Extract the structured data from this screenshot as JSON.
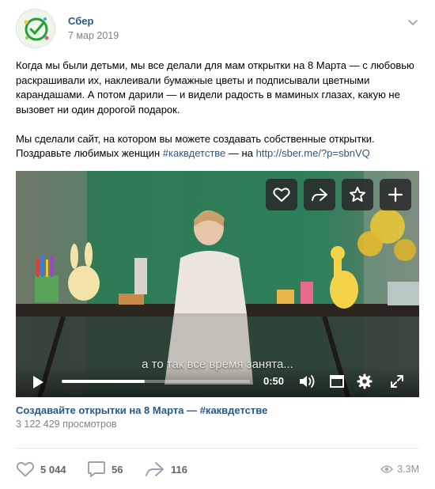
{
  "post": {
    "author": "Сбер",
    "date": "7 мар 2019",
    "text_p1": "Когда мы были детьми, мы все делали для мам открытки на 8 Марта — с любовью раскрашивали их, наклеивали бумажные цветы и подписывали цветными карандашами. А потом дарили — и видели радость в маминых глазах, какую не вызовет ни один дорогой подарок.",
    "text_p2_line1": "Мы сделали сайт, на котором вы можете создавать собственные открытки.",
    "text_p2_prefix": "Поздравьте любимых женщин",
    "hashtag": "#каквдетстве",
    "text_p2_middle": "— на",
    "link": "http://sber.me/?p=sbnVQ"
  },
  "video": {
    "subtitle": "а то так всё время занята...",
    "time": "0:50",
    "progress": 0.44,
    "title": "Создавайте открытки на 8 Марта — #каквдетстве",
    "views": "3 122 429 просмотров"
  },
  "actions": {
    "likes": "5 044",
    "comments": "56",
    "shares": "116",
    "views": "3.3M"
  },
  "colors": {
    "link": "#2a5885",
    "muted": "#828282",
    "icon": "#99a2ad"
  }
}
